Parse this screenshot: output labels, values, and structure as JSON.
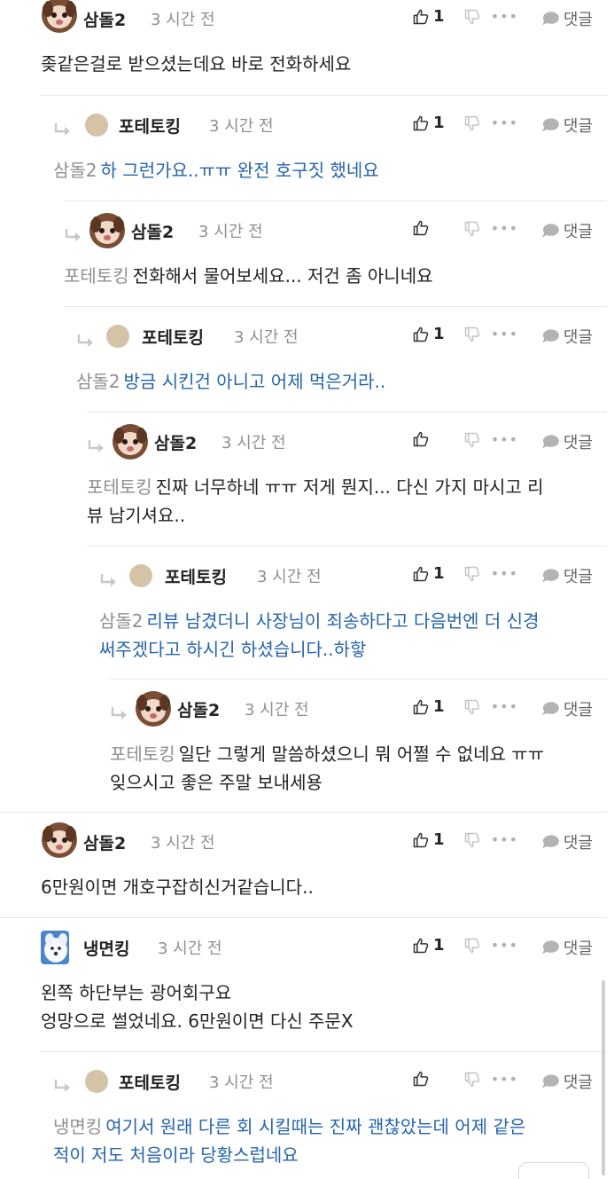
{
  "ui": {
    "time": "3 시간 전",
    "reply_label": "댓글",
    "more_dots": "•••"
  },
  "comments": [
    {
      "nick": "삼돌2",
      "like_count": "1",
      "mention": "",
      "text": "좆같은걸로 받으셨는데요 바로 전화하세요",
      "text2": ""
    },
    {
      "nick": "포테토킹",
      "like_count": "1",
      "mention": "삼돌2",
      "text": "하 그런가요..ㅠㅠ 완전 호구짓 했네요",
      "text2": ""
    },
    {
      "nick": "삼돌2",
      "like_count": "",
      "mention": "포테토킹",
      "text": "전화해서 물어보세요... 저건 좀 아니네요",
      "text2": ""
    },
    {
      "nick": "포테토킹",
      "like_count": "1",
      "mention": "삼돌2",
      "text": "방금 시킨건 아니고 어제 먹은거라..",
      "text2": ""
    },
    {
      "nick": "삼돌2",
      "like_count": "",
      "mention": "포테토킹",
      "text": "진짜 너무하네 ㅠㅠ 저게 뭔지... 다신 가지 마시고 리",
      "text2": "뷰 남기셔요.."
    },
    {
      "nick": "포테토킹",
      "like_count": "1",
      "mention": "삼돌2",
      "text": "리뷰 남겼더니 사장님이 죄송하다고 다음번엔 더 신경",
      "text2": "써주겠다고 하시긴 하셨습니다..하핳"
    },
    {
      "nick": "삼돌2",
      "like_count": "1",
      "mention": "포테토킹",
      "text": "일단 그렇게 말씀하셨으니 뭐 어쩔 수 없네요 ㅠㅠ",
      "text2": "잊으시고 좋은 주말 보내세용"
    },
    {
      "nick": "삼돌2",
      "like_count": "1",
      "mention": "",
      "text": "6만원이면 개호구잡히신거같습니다..",
      "text2": ""
    },
    {
      "nick": "냉면킹",
      "like_count": "1",
      "mention": "",
      "text": "왼쪽 하단부는 광어회구요",
      "text2": "엉망으로 썰었네요. 6만원이면 다신 주문X"
    },
    {
      "nick": "포테토킹",
      "like_count": "",
      "mention": "냉면킹",
      "text": "여기서 원래 다른 회 시킬때는 진짜 괜찮았는데 어제 같은",
      "text2": "적이 저도 처음이라 당황스럽네요"
    }
  ]
}
